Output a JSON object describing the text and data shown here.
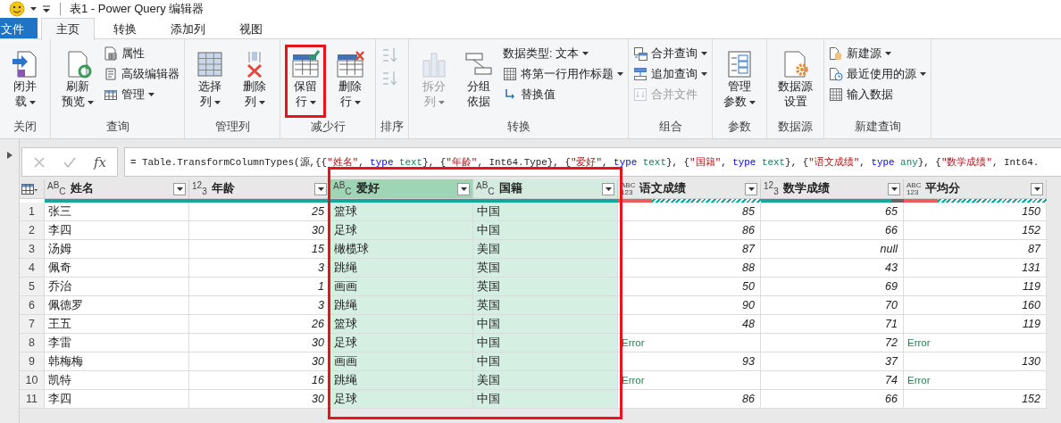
{
  "title_bar": {
    "title": "表1 - Power Query 编辑器"
  },
  "tabs": [
    {
      "label": "文件",
      "kind": "file",
      "selected": false
    },
    {
      "label": "主页",
      "kind": "tab",
      "selected": true
    },
    {
      "label": "转换",
      "kind": "tab",
      "selected": false
    },
    {
      "label": "添加列",
      "kind": "tab",
      "selected": false
    },
    {
      "label": "视图",
      "kind": "tab",
      "selected": false
    }
  ],
  "ribbon": {
    "groups": [
      {
        "label": "关闭",
        "items": [
          {
            "kind": "large",
            "lines": [
              "闭并",
              "载"
            ],
            "dropdown": true
          }
        ]
      },
      {
        "label": "查询",
        "items": [
          {
            "kind": "large",
            "lines": [
              "刷新",
              "预览"
            ],
            "dropdown": true
          },
          {
            "kind": "small",
            "label": "属性",
            "dropdown": false
          },
          {
            "kind": "small",
            "label": "高级编辑器",
            "dropdown": false
          },
          {
            "kind": "small",
            "label": "管理",
            "dropdown": true
          }
        ]
      },
      {
        "label": "管理列",
        "items": [
          {
            "kind": "large",
            "lines": [
              "选择",
              "列"
            ],
            "dropdown": true
          },
          {
            "kind": "large",
            "lines": [
              "删除",
              "列"
            ],
            "dropdown": true
          }
        ]
      },
      {
        "label": "减少行",
        "items": [
          {
            "kind": "large",
            "lines": [
              "保留",
              "行"
            ],
            "dropdown": true,
            "highlighted": true
          },
          {
            "kind": "large",
            "lines": [
              "删除",
              "行"
            ],
            "dropdown": true
          }
        ]
      },
      {
        "label": "排序",
        "items": [
          {
            "kind": "icon"
          },
          {
            "kind": "icon"
          }
        ]
      },
      {
        "label": "转换",
        "items": [
          {
            "kind": "large",
            "lines": [
              "拆分",
              "列"
            ],
            "dropdown": true,
            "disabled": true
          },
          {
            "kind": "large",
            "lines": [
              "分组",
              "依据"
            ],
            "dropdown": false
          },
          {
            "kind": "small",
            "label": "数据类型: 文本",
            "dropdown": true
          },
          {
            "kind": "small",
            "label": "将第一行用作标题",
            "dropdown": true
          },
          {
            "kind": "small",
            "label": "替换值",
            "dropdown": false
          }
        ]
      },
      {
        "label": "组合",
        "items": [
          {
            "kind": "small",
            "label": "合并查询",
            "dropdown": true
          },
          {
            "kind": "small",
            "label": "追加查询",
            "dropdown": true
          },
          {
            "kind": "small",
            "label": "合并文件",
            "dropdown": false,
            "disabled": true
          }
        ]
      },
      {
        "label": "参数",
        "items": [
          {
            "kind": "large",
            "lines": [
              "管理",
              "参数"
            ],
            "dropdown": true
          }
        ]
      },
      {
        "label": "数据源",
        "items": [
          {
            "kind": "large",
            "lines": [
              "数据源",
              "设置"
            ],
            "dropdown": false
          }
        ]
      },
      {
        "label": "新建查询",
        "items": [
          {
            "kind": "small",
            "label": "新建源",
            "dropdown": true
          },
          {
            "kind": "small",
            "label": "最近使用的源",
            "dropdown": true
          },
          {
            "kind": "small",
            "label": "输入数据",
            "dropdown": false
          }
        ]
      }
    ]
  },
  "formula_bar": {
    "fx_label": "fx",
    "segments": [
      {
        "kind": "plain",
        "text": "= Table.TransformColumnTypes(源,{{"
      },
      {
        "kind": "string",
        "text": "\"姓名\""
      },
      {
        "kind": "plain",
        "text": ", "
      },
      {
        "kind": "keyword",
        "text": "type"
      },
      {
        "kind": "type",
        "text": " text"
      },
      {
        "kind": "plain",
        "text": "}, {"
      },
      {
        "kind": "string",
        "text": "\"年龄\""
      },
      {
        "kind": "plain",
        "text": ", Int64.Type}, {"
      },
      {
        "kind": "string",
        "text": "\"爱好\""
      },
      {
        "kind": "plain",
        "text": ", "
      },
      {
        "kind": "keyword",
        "text": "type"
      },
      {
        "kind": "type",
        "text": " text"
      },
      {
        "kind": "plain",
        "text": "}, {"
      },
      {
        "kind": "string",
        "text": "\"国籍\""
      },
      {
        "kind": "plain",
        "text": ", "
      },
      {
        "kind": "keyword",
        "text": "type"
      },
      {
        "kind": "type",
        "text": " text"
      },
      {
        "kind": "plain",
        "text": "}, {"
      },
      {
        "kind": "string",
        "text": "\"语文成绩\""
      },
      {
        "kind": "plain",
        "text": ", "
      },
      {
        "kind": "keyword",
        "text": "type"
      },
      {
        "kind": "type",
        "text": " any"
      },
      {
        "kind": "plain",
        "text": "}, {"
      },
      {
        "kind": "string",
        "text": "\"数学成绩\""
      },
      {
        "kind": "plain",
        "text": ", Int64."
      }
    ]
  },
  "table": {
    "highlight_selected": true,
    "columns": [
      {
        "name": "姓名",
        "kind": "text",
        "type_glyph": [
          "A",
          "B",
          "C"
        ],
        "quality_bar": {
          "kind": "valid"
        },
        "selected": false,
        "focused": false
      },
      {
        "name": "年龄",
        "kind": "number",
        "type_glyph": [
          "1",
          "2",
          "3"
        ],
        "quality_bar": {
          "kind": "valid"
        },
        "selected": false,
        "focused": false
      },
      {
        "name": "爱好",
        "kind": "text",
        "type_glyph": [
          "A",
          "B",
          "C"
        ],
        "quality_bar": {
          "kind": "valid"
        },
        "selected": true,
        "focused": true
      },
      {
        "name": "国籍",
        "kind": "text",
        "type_glyph": [
          "A",
          "B",
          "C"
        ],
        "quality_bar": {
          "kind": "valid"
        },
        "selected": true,
        "focused": false
      },
      {
        "name": "语文成绩",
        "kind": "any",
        "type_glyph": [
          "ABC",
          "123"
        ],
        "quality_bar": {
          "kind": "mixed"
        },
        "selected": false,
        "focused": false
      },
      {
        "name": "数学成绩",
        "kind": "number",
        "type_glyph": [
          "1",
          "2",
          "3"
        ],
        "quality_bar": {
          "kind": "empty"
        },
        "selected": false,
        "focused": false
      },
      {
        "name": "平均分",
        "kind": "any",
        "type_glyph": [
          "ABC",
          "123"
        ],
        "quality_bar": {
          "kind": "mixed"
        },
        "selected": false,
        "focused": false
      }
    ],
    "rows": [
      {
        "number": "1",
        "cells": [
          "张三",
          "25",
          "篮球",
          "中国",
          "85",
          "65",
          "150"
        ]
      },
      {
        "number": "2",
        "cells": [
          "李四",
          "30",
          "足球",
          "中国",
          "86",
          "66",
          "152"
        ]
      },
      {
        "number": "3",
        "cells": [
          "汤姆",
          "15",
          "橄榄球",
          "美国",
          "87",
          {
            "kind": "null",
            "text": "null"
          },
          "87"
        ]
      },
      {
        "number": "4",
        "cells": [
          "佩奇",
          "3",
          "跳绳",
          "英国",
          "88",
          "43",
          "131"
        ]
      },
      {
        "number": "5",
        "cells": [
          "乔治",
          "1",
          "画画",
          "英国",
          "50",
          "69",
          "119"
        ]
      },
      {
        "number": "6",
        "cells": [
          "佩德罗",
          "3",
          "跳绳",
          "英国",
          "90",
          "70",
          "160"
        ]
      },
      {
        "number": "7",
        "cells": [
          "王五",
          "26",
          "篮球",
          "中国",
          "48",
          "71",
          "119"
        ]
      },
      {
        "number": "8",
        "cells": [
          "李雷",
          "30",
          "足球",
          "中国",
          {
            "kind": "error",
            "text": "Error"
          },
          "72",
          {
            "kind": "error",
            "text": "Error"
          }
        ]
      },
      {
        "number": "9",
        "cells": [
          "韩梅梅",
          "30",
          "画画",
          "中国",
          "93",
          "37",
          "130"
        ]
      },
      {
        "number": "10",
        "cells": [
          "凯特",
          "16",
          "跳绳",
          "美国",
          {
            "kind": "error",
            "text": "Error"
          },
          "74",
          {
            "kind": "error",
            "text": "Error"
          }
        ]
      },
      {
        "number": "11",
        "cells": [
          "李四",
          "30",
          "足球",
          "中国",
          "86",
          "66",
          "152"
        ]
      }
    ]
  }
}
